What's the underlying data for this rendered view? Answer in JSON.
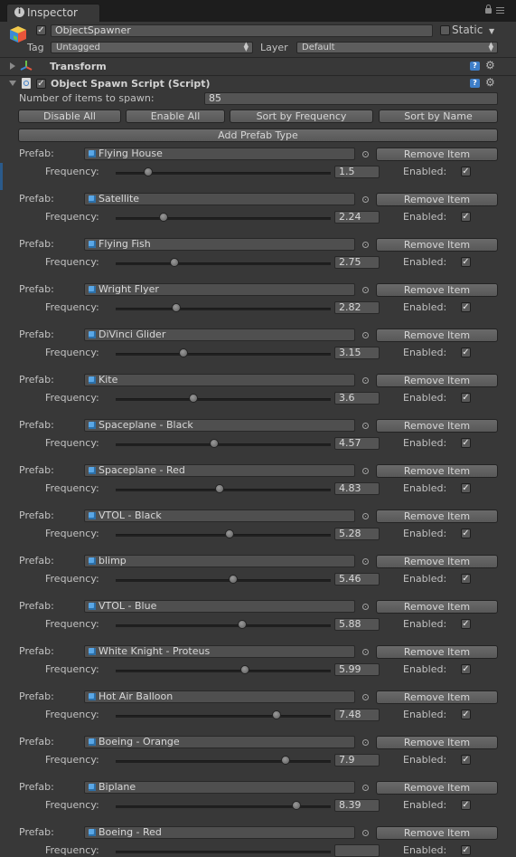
{
  "window": {
    "tab_title": "Inspector"
  },
  "gameobject": {
    "name": "ObjectSpawner",
    "static_label": "Static",
    "tag_label": "Tag",
    "tag_value": "Untagged",
    "layer_label": "Layer",
    "layer_value": "Default"
  },
  "transform": {
    "title": "Transform"
  },
  "script": {
    "title": "Object Spawn Script (Script)",
    "count_label": "Number of items to spawn:",
    "count_value": "85"
  },
  "buttons": {
    "disable_all": "Disable All",
    "enable_all": "Enable All",
    "sort_frequency": "Sort by Frequency",
    "sort_name": "Sort by Name",
    "add_prefab": "Add Prefab Type"
  },
  "row_labels": {
    "prefab": "Prefab:",
    "frequency": "Frequency:",
    "remove": "Remove Item",
    "enabled": "Enabled:"
  },
  "slider_max": 10,
  "items": [
    {
      "name": "Flying House",
      "frequency": "1.5",
      "enabled": true
    },
    {
      "name": "Satellite",
      "frequency": "2.24",
      "enabled": true
    },
    {
      "name": "Flying Fish",
      "frequency": "2.75",
      "enabled": true
    },
    {
      "name": "Wright Flyer",
      "frequency": "2.82",
      "enabled": true
    },
    {
      "name": "DiVinci Glider",
      "frequency": "3.15",
      "enabled": true
    },
    {
      "name": "Kite",
      "frequency": "3.6",
      "enabled": true
    },
    {
      "name": "Spaceplane - Black",
      "frequency": "4.57",
      "enabled": true
    },
    {
      "name": "Spaceplane - Red",
      "frequency": "4.83",
      "enabled": true
    },
    {
      "name": "VTOL - Black",
      "frequency": "5.28",
      "enabled": true
    },
    {
      "name": "blimp",
      "frequency": "5.46",
      "enabled": true
    },
    {
      "name": "VTOL - Blue",
      "frequency": "5.88",
      "enabled": true
    },
    {
      "name": "White Knight - Proteus",
      "frequency": "5.99",
      "enabled": true
    },
    {
      "name": "Hot Air Balloon",
      "frequency": "7.48",
      "enabled": true
    },
    {
      "name": "Boeing - Orange",
      "frequency": "7.9",
      "enabled": true
    },
    {
      "name": "Biplane",
      "frequency": "8.39",
      "enabled": true
    },
    {
      "name": "Boeing - Red",
      "frequency": "",
      "enabled": true
    }
  ]
}
